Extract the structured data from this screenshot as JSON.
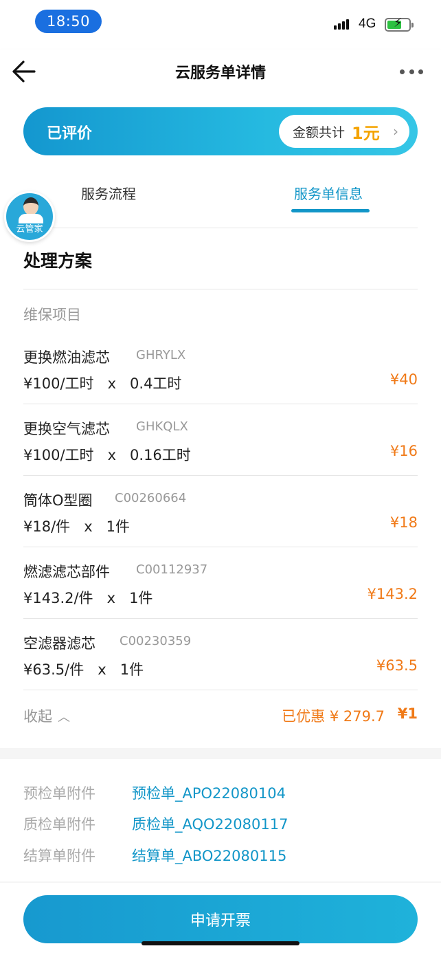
{
  "status_bar": {
    "time": "18:50",
    "network": "4G"
  },
  "nav": {
    "title": "云服务单详情"
  },
  "status_card": {
    "status": "已评价",
    "amount_label": "金额共计",
    "amount_value": "1元"
  },
  "tabs": [
    {
      "label": "服务流程",
      "active": false
    },
    {
      "label": "服务单信息",
      "active": true
    }
  ],
  "assistant": {
    "label": "云管家"
  },
  "plan": {
    "title": "处理方案",
    "subhead": "维保项目",
    "items": [
      {
        "name": "更换燃油滤芯",
        "code": "GHRYLX",
        "unit_price": "¥100/工时",
        "times": "x",
        "quantity": "0.4工时",
        "price": "¥40"
      },
      {
        "name": "更换空气滤芯",
        "code": "GHKQLX",
        "unit_price": "¥100/工时",
        "times": "x",
        "quantity": "0.16工时",
        "price": "¥16"
      },
      {
        "name": "筒体O型圈",
        "code": "C00260664",
        "unit_price": "¥18/件",
        "times": "x",
        "quantity": "1件",
        "price": "¥18"
      },
      {
        "name": "燃滤滤芯部件",
        "code": "C00112937",
        "unit_price": "¥143.2/件",
        "times": "x",
        "quantity": "1件",
        "price": "¥143.2"
      },
      {
        "name": "空滤器滤芯",
        "code": "C00230359",
        "unit_price": "¥63.5/件",
        "times": "x",
        "quantity": "1件",
        "price": "¥63.5"
      }
    ],
    "collapse_label": "收起",
    "discount": "已优惠 ¥ 279.7",
    "total": "¥1"
  },
  "attachments": [
    {
      "label": "预检单附件",
      "link": "预检单_APO22080104"
    },
    {
      "label": "质检单附件",
      "link": "质检单_AQO22080117"
    },
    {
      "label": "结算单附件",
      "link": "结算单_ABO22080115"
    }
  ],
  "actions": {
    "invoice": "申请开票"
  },
  "colors": {
    "accent": "#1296c8",
    "price": "#f07a18",
    "amount": "#f4a300"
  }
}
